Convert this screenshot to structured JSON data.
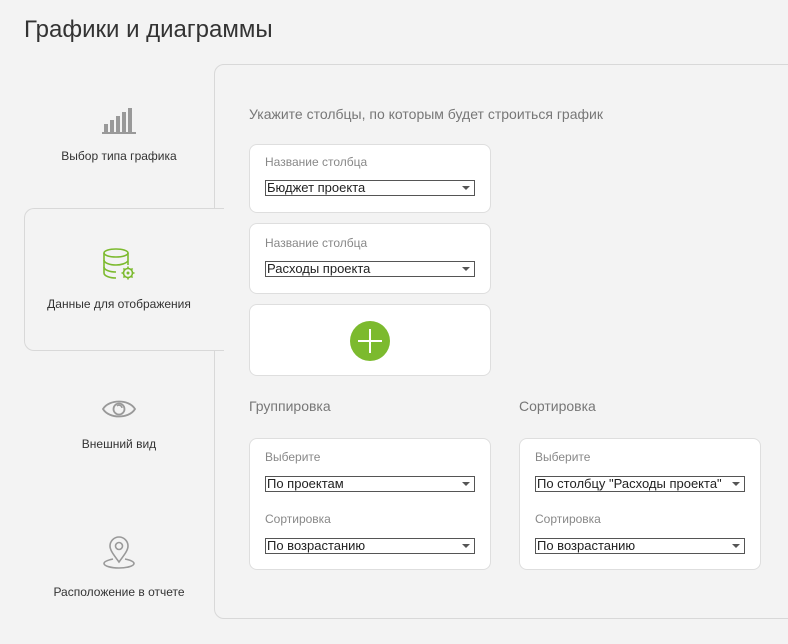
{
  "page": {
    "title": "Графики и диаграммы"
  },
  "nav": {
    "items": [
      {
        "label": "Выбор типа графика",
        "icon": "bar-chart-icon"
      },
      {
        "label": "Данные для отображения",
        "icon": "database-settings-icon",
        "active": true
      },
      {
        "label": "Внешний вид",
        "icon": "eye-icon"
      },
      {
        "label": "Расположение в отчете",
        "icon": "map-pin-icon"
      }
    ]
  },
  "columns": {
    "heading": "Укажите столбцы, по которым будет строиться график",
    "fields": [
      {
        "label": "Название столбца",
        "value": "Бюджет проекта"
      },
      {
        "label": "Название столбца",
        "value": "Расходы проекта"
      }
    ],
    "add_icon": "plus-icon"
  },
  "grouping": {
    "heading": "Группировка",
    "select_label": "Выберите",
    "select_value": "По проектам",
    "sort_label": "Сортировка",
    "sort_value": "По возрастанию"
  },
  "sorting": {
    "heading": "Сортировка",
    "select_label": "Выберите",
    "select_value": "По столбцу \"Расходы проекта\"",
    "sort_label": "Сортировка",
    "sort_value": "По возрастанию"
  },
  "colors": {
    "accent": "#7cba2e",
    "icon_gray": "#999999"
  }
}
